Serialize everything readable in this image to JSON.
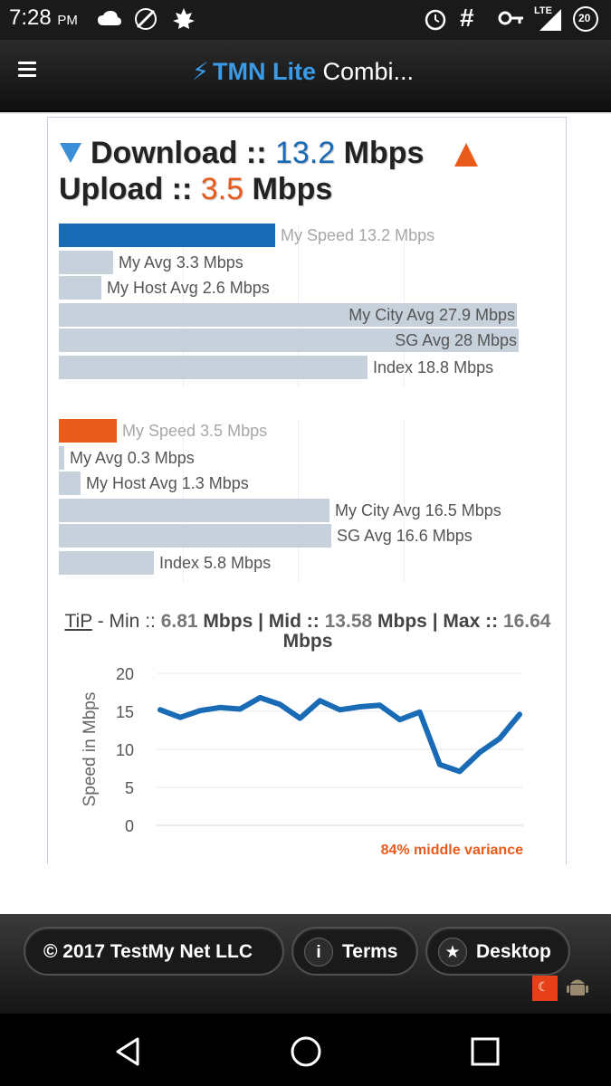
{
  "status_bar": {
    "time": "7:28",
    "ampm": "PM",
    "network": "LTE",
    "battery_level": "20",
    "left_icons": [
      "cloud-icon",
      "plug-icon",
      "maple-leaf-icon"
    ],
    "right_icons": [
      "alarm-icon",
      "hash-icon",
      "key-icon",
      "signal-icon",
      "battery-icon"
    ]
  },
  "app_bar": {
    "brand_main": "TMN Lite",
    "brand_rest": "Combi..."
  },
  "results": {
    "download_label": "Download ::",
    "download_value": "13.2",
    "download_unit": "Mbps",
    "upload_label": "Upload ::",
    "upload_value": "3.5",
    "upload_unit": "Mbps"
  },
  "download_bars": [
    {
      "label": "My Speed 13.2 Mbps",
      "value": 13.2,
      "highlight": true
    },
    {
      "label": "My Avg 3.3 Mbps",
      "value": 3.3
    },
    {
      "label": "My Host Avg 2.6 Mbps",
      "value": 2.6
    },
    {
      "label": "My City Avg 27.9 Mbps",
      "value": 27.9
    },
    {
      "label": "SG Avg 28 Mbps",
      "value": 28
    },
    {
      "label": "Index 18.8 Mbps",
      "value": 18.8
    }
  ],
  "upload_bars": [
    {
      "label": "My Speed 3.5 Mbps",
      "value": 3.5,
      "highlight": true
    },
    {
      "label": "My Avg 0.3 Mbps",
      "value": 0.3
    },
    {
      "label": "My Host Avg 1.3 Mbps",
      "value": 1.3
    },
    {
      "label": "My City Avg 16.5 Mbps",
      "value": 16.5
    },
    {
      "label": "SG Avg 16.6 Mbps",
      "value": 16.6
    },
    {
      "label": "Index 5.8 Mbps",
      "value": 5.8
    }
  ],
  "bar_scale_max": 28,
  "colors": {
    "download": "#1a6bb5",
    "upload": "#e85b1a",
    "compare": "#c7d1db",
    "line": "#1a6bb5"
  },
  "tip": {
    "tip_label": "TiP",
    "min_label": "- Min ::",
    "min_value": "6.81",
    "mid_label": "Mbps | Mid ::",
    "mid_value": "13.58",
    "max_label": "Mbps | Max ::",
    "max_value": "16.64",
    "unit": "Mbps"
  },
  "chart_data": {
    "type": "line",
    "ylabel": "Speed in Mbps",
    "ylim": [
      0,
      20
    ],
    "yticks": [
      "20",
      "15",
      "10",
      "5",
      "0"
    ],
    "grid": true,
    "series": [
      {
        "values": [
          15.2,
          14.2,
          15.1,
          15.5,
          15.3,
          16.8,
          15.9,
          14.1,
          16.4,
          15.2,
          15.6,
          15.8,
          13.9,
          14.9,
          8.0,
          7.1,
          9.6,
          11.4,
          14.6
        ]
      }
    ],
    "annotation": "84% middle variance"
  },
  "footer": {
    "copyright": "© 2017 TestMy Net LLC",
    "terms": "Terms",
    "desktop": "Desktop",
    "terms_icon": "i",
    "desktop_icon": "★"
  }
}
